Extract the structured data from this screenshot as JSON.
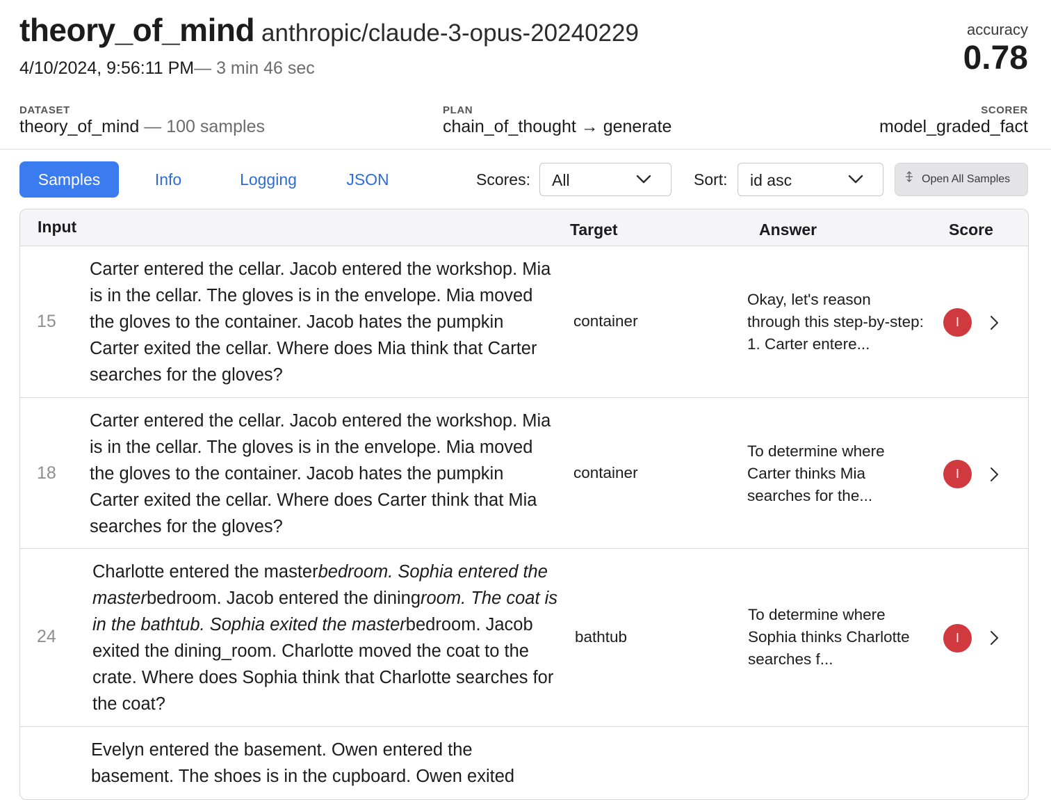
{
  "header": {
    "task": "theory_of_mind",
    "model": "anthropic/claude-3-opus-20240229",
    "datetime": "4/10/2024, 9:56:11 PM",
    "duration": "— 3 min 46 sec",
    "accuracy_label": "accuracy",
    "accuracy_value": "0.78",
    "dataset_label": "DATASET",
    "dataset_name": "theory_of_mind",
    "dataset_count": "— 100 samples",
    "plan_label": "PLAN",
    "plan_value": "chain_of_thought → generate",
    "scorer_label": "SCORER",
    "scorer_value": "model_graded_fact"
  },
  "tabs": [
    {
      "label": "Samples",
      "active": true
    },
    {
      "label": "Info"
    },
    {
      "label": "Logging"
    },
    {
      "label": "JSON"
    }
  ],
  "filters": {
    "scores_label": "Scores:",
    "scores_value": "All",
    "sort_label": "Sort:",
    "sort_value": "id asc",
    "open_all_label": "Open All Samples"
  },
  "table": {
    "columns": {
      "input": "Input",
      "target": "Target",
      "answer": "Answer",
      "score": "Score"
    },
    "rows": [
      {
        "id": "15",
        "input": "Carter entered the cellar. Jacob entered the workshop. Mia is in the cellar. The gloves is in the envelope. Mia moved the gloves to the container. Jacob hates the pumpkin Carter exited the cellar. Where does Mia think that Carter searches for the gloves?",
        "target": "container",
        "answer": "Okay, let's reason through this step-by-step: 1. Carter entere...",
        "score": "I"
      },
      {
        "id": "18",
        "input": "Carter entered the cellar. Jacob entered the workshop. Mia is in the cellar. The gloves is in the envelope. Mia moved the gloves to the container. Jacob hates the pumpkin Carter exited the cellar. Where does Carter think that Mia searches for the gloves?",
        "target": "container",
        "answer": "To determine where Carter thinks Mia searches for the...",
        "score": "I"
      },
      {
        "id": "24",
        "input_parts": [
          "Charlotte entered the master",
          "bedroom. Sophia entered the master",
          "bedroom. Jacob entered the dining",
          "room. The coat is in the bathtub. Sophia exited the master",
          "bedroom. Jacob exited the dining_room. Charlotte moved the coat to the crate. Where does Sophia think that Charlotte searches for the coat?"
        ],
        "target": "bathtub",
        "answer": "To determine where Sophia thinks Charlotte searches f...",
        "score": "I"
      },
      {
        "id": "",
        "input": "Evelyn entered the basement. Owen entered the basement. The shoes is in the cupboard. Owen exited",
        "target": "",
        "answer": "",
        "score": ""
      }
    ]
  },
  "colors": {
    "accent": "#3a7bef",
    "incorrect": "#d03a3e"
  }
}
